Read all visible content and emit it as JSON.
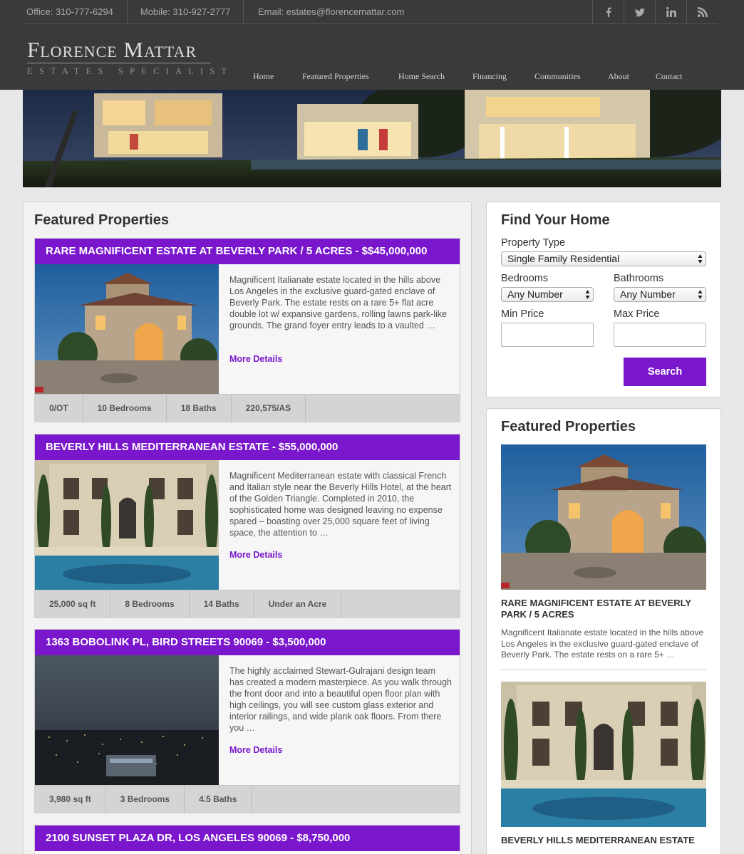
{
  "header": {
    "office": "Office: 310-777-6294",
    "mobile": "Mobile: 310-927-2777",
    "email": "Email: estates@florencemattar.com",
    "logo_main": "Florence Mattar",
    "logo_sub": "ESTATES SPECIALIST",
    "social_icons": [
      "facebook-icon",
      "twitter-icon",
      "linkedin-icon",
      "rss-icon"
    ],
    "nav": [
      "Home",
      "Featured Properties",
      "Home Search",
      "Financing",
      "Communities",
      "About",
      "Contact"
    ]
  },
  "colors": {
    "accent": "#7a17cd",
    "header_bg": "#3a3a3a",
    "page_bg": "#e8e8e8"
  },
  "main": {
    "title": "Featured Properties",
    "more_label": "More Details",
    "listings": [
      {
        "title": "RARE MAGNIFICENT ESTATE AT BEVERLY PARK / 5 ACRES - $$45,000,000",
        "description": "Magnificent Italianate estate located in the hills above Los Angeles in the exclusive guard-gated enclave of Beverly Park. The estate rests on a rare 5+ flat acre double lot w/ expansive gardens, rolling lawns park-like grounds. The grand foyer entry leads to a vaulted …",
        "stats": [
          "0/OT",
          "10 Bedrooms",
          "18 Baths",
          "220,575/AS"
        ]
      },
      {
        "title": "BEVERLY HILLS MEDITERRANEAN ESTATE - $55,000,000",
        "description": "Magnificent Mediterranean estate with classical French and Italian style near the Beverly Hills Hotel, at the heart of the Golden Triangle. Completed in 2010, the sophisticated home was designed leaving no expense spared – boasting over 25,000 square feet of living space, the attention to …",
        "stats": [
          "25,000 sq ft",
          "8 Bedrooms",
          "14 Baths",
          "Under an Acre"
        ]
      },
      {
        "title": "1363 BOBOLINK PL, BIRD STREETS 90069 - $3,500,000",
        "description": "The highly acclaimed Stewart-Gulrajani design team has created a modern masterpiece. As you walk through the front door and into a beautiful open floor plan with high ceilings, you will see custom glass exterior and interior railings, and wide plank oak floors. From there you …",
        "stats": [
          "3,980 sq ft",
          "3 Bedrooms",
          "4.5 Baths"
        ]
      },
      {
        "title": "2100 SUNSET PLAZA DR, LOS ANGELES 90069 - $8,750,000"
      }
    ]
  },
  "search": {
    "title": "Find Your Home",
    "property_type_label": "Property Type",
    "property_type_value": "Single Family Residential",
    "bedrooms_label": "Bedrooms",
    "bedrooms_value": "Any Number",
    "bathrooms_label": "Bathrooms",
    "bathrooms_value": "Any Number",
    "min_price_label": "Min Price",
    "max_price_label": "Max Price",
    "button": "Search"
  },
  "sidebar_featured": {
    "title": "Featured Properties",
    "items": [
      {
        "title": "RARE MAGNIFICENT ESTATE AT BEVERLY PARK / 5 ACRES",
        "description": "Magnificent Italianate estate located in the hills above Los Angeles in the exclusive guard-gated enclave of Beverly Park. The estate rests on a rare 5+ …"
      },
      {
        "title": "BEVERLY HILLS MEDITERRANEAN ESTATE"
      }
    ]
  }
}
